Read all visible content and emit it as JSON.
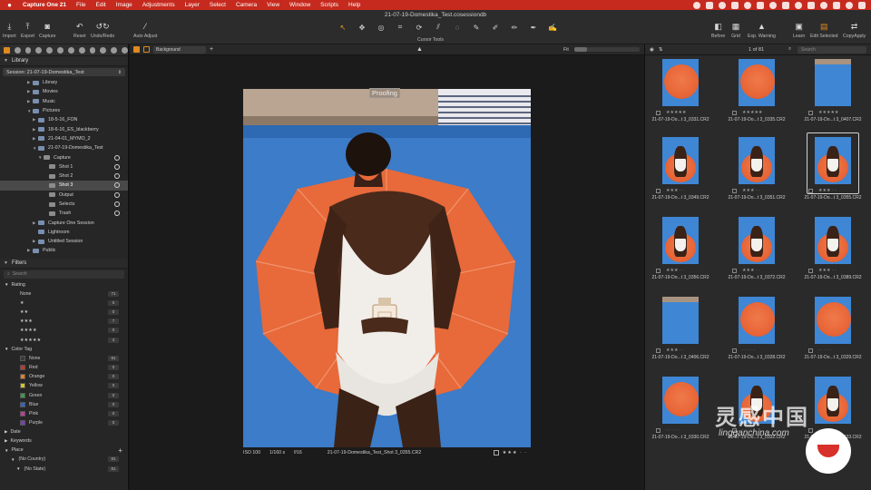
{
  "menubar": {
    "app": "Capture One 21",
    "items": [
      "File",
      "Edit",
      "Image",
      "Adjustments",
      "Layer",
      "Select",
      "Camera",
      "View",
      "Window",
      "Scripts",
      "Help"
    ]
  },
  "window": {
    "title": "21-07-19-Domestika_Test.cosessiondb"
  },
  "toolbar": {
    "left_buttons": [
      {
        "label": "Import",
        "icon": "import-icon"
      },
      {
        "label": "Export",
        "icon": "export-icon"
      },
      {
        "label": "Capture",
        "icon": "camera-icon"
      },
      {
        "label": "Reset",
        "icon": "reset-icon"
      },
      {
        "label": "Undo/Redo",
        "icon": "undo-icon"
      },
      {
        "label": "Auto Adjust",
        "icon": "wand-icon"
      }
    ],
    "cursor_tools_label": "Cursor Tools",
    "right_buttons": [
      {
        "label": "Before",
        "icon": "before-icon"
      },
      {
        "label": "Grid",
        "icon": "grid-icon"
      },
      {
        "label": "Exp. Warning",
        "icon": "warning-icon"
      },
      {
        "label": "Learn",
        "icon": "learn-icon"
      },
      {
        "label": "Edit Selected",
        "icon": "edit-icon"
      },
      {
        "label": "CopyApply",
        "icon": "copy-apply-icon"
      }
    ]
  },
  "library": {
    "title": "Library",
    "session": "Session: 21-07-19-Domestika_Test",
    "tree": [
      {
        "label": "Library",
        "depth": 2
      },
      {
        "label": "Movies",
        "depth": 2
      },
      {
        "label": "Music",
        "depth": 2
      },
      {
        "label": "Pictures",
        "depth": 2
      },
      {
        "label": "18-5-16_FON",
        "depth": 3
      },
      {
        "label": "18-6-16_ES_blackberry",
        "depth": 3
      },
      {
        "label": "21-04-01_MYMO_2",
        "depth": 3
      },
      {
        "label": "21-07-19-Domestika_Test",
        "depth": 3
      },
      {
        "label": "Capture",
        "depth": 4
      },
      {
        "label": "Shot 1",
        "depth": 5
      },
      {
        "label": "Shot 2",
        "depth": 5
      },
      {
        "label": "Shot 3",
        "depth": 5
      },
      {
        "label": "Output",
        "depth": 4
      },
      {
        "label": "Selects",
        "depth": 4
      },
      {
        "label": "Trash",
        "depth": 4
      },
      {
        "label": "Capture One Session",
        "depth": 3
      },
      {
        "label": "Lightroom",
        "depth": 3
      },
      {
        "label": "Untitled Session",
        "depth": 3
      },
      {
        "label": "Public",
        "depth": 2
      }
    ]
  },
  "filters": {
    "title": "Filters",
    "search_placeholder": "Search",
    "rating_title": "Rating",
    "ratings": [
      {
        "label": "None",
        "count": "71"
      },
      {
        "label": "★",
        "count": "0"
      },
      {
        "label": "★★",
        "count": "0"
      },
      {
        "label": "★★★",
        "count": "7"
      },
      {
        "label": "★★★★",
        "count": "0"
      },
      {
        "label": "★★★★★",
        "count": "3"
      }
    ],
    "color_title": "Color Tag",
    "colors": [
      {
        "label": "None",
        "count": "81",
        "color": "#3a3a3a"
      },
      {
        "label": "Red",
        "count": "0",
        "color": "#c0392b"
      },
      {
        "label": "Orange",
        "count": "0",
        "color": "#e67e22"
      },
      {
        "label": "Yellow",
        "count": "0",
        "color": "#d4c22a"
      },
      {
        "label": "Green",
        "count": "0",
        "color": "#3f9b45"
      },
      {
        "label": "Blue",
        "count": "0",
        "color": "#3167c4"
      },
      {
        "label": "Pink",
        "count": "0",
        "color": "#c23ba0"
      },
      {
        "label": "Purple",
        "count": "0",
        "color": "#7b3fb8"
      }
    ],
    "date_title": "Date",
    "keywords_title": "Keywords",
    "place_title": "Place",
    "places": [
      {
        "label": "(No Country)",
        "count": "81"
      },
      {
        "label": "(No State)",
        "count": "81"
      }
    ]
  },
  "viewer": {
    "style": "Background",
    "fit": "Fit",
    "proofing": "Proofing",
    "iso": "ISO 100",
    "shutter": "1/160 s",
    "aperture": "f/16",
    "filename": "21-07-19-Domestika_Test_Shot 3_0355.CR2",
    "rating_stars": "★★★ · ·"
  },
  "browser": {
    "count": "1 of 81",
    "search_placeholder": "Search",
    "thumbs": [
      {
        "name": "21-07-19-Do...t 3_0331.CR2",
        "stars": "★★★★★",
        "kind": "umbrella"
      },
      {
        "name": "21-07-19-Do...t 3_0335.CR2",
        "stars": "★★★★★",
        "kind": "umbrella"
      },
      {
        "name": "21-07-19-Do...t 3_0407.CR2",
        "stars": "★★★★★",
        "kind": "sky"
      },
      {
        "name": "21-07-19-Do...t 3_0349.CR2",
        "stars": "★★★ · ·",
        "kind": "person"
      },
      {
        "name": "21-07-19-Do...t 3_0351.CR2",
        "stars": "★★★ · ·",
        "kind": "person"
      },
      {
        "name": "21-07-19-Do...t 3_0355.CR2",
        "stars": "★★★ · ·",
        "kind": "person",
        "selected": true
      },
      {
        "name": "21-07-19-Do...t 3_0356.CR2",
        "stars": "★★★ · ·",
        "kind": "person"
      },
      {
        "name": "21-07-19-Do...t 3_0372.CR2",
        "stars": "★★★ · ·",
        "kind": "person"
      },
      {
        "name": "21-07-19-Do...t 3_0389.CR2",
        "stars": "★★★ · ·",
        "kind": "person"
      },
      {
        "name": "21-07-19-Do...t 3_0406.CR2",
        "stars": "★★★ · ·",
        "kind": "sky"
      },
      {
        "name": "21-07-19-Do...t 3_0328.CR2",
        "stars": "· · · · ·",
        "kind": "umbrella"
      },
      {
        "name": "21-07-19-Do...t 3_0329.CR2",
        "stars": "· · · · ·",
        "kind": "umbrella"
      },
      {
        "name": "21-07-19-Do...t 3_0330.CR2",
        "stars": "· · · · ·",
        "kind": "umbrella"
      },
      {
        "name": "21-07-19-Do...t 3_0332.CR2",
        "stars": "· · · · ·",
        "kind": "person"
      },
      {
        "name": "21-07-19-Do...t 3_0333.CR2",
        "stars": "· · · · ·",
        "kind": "person"
      }
    ]
  },
  "watermark": {
    "text": "灵感中国",
    "sub": "lingganchina.com"
  }
}
